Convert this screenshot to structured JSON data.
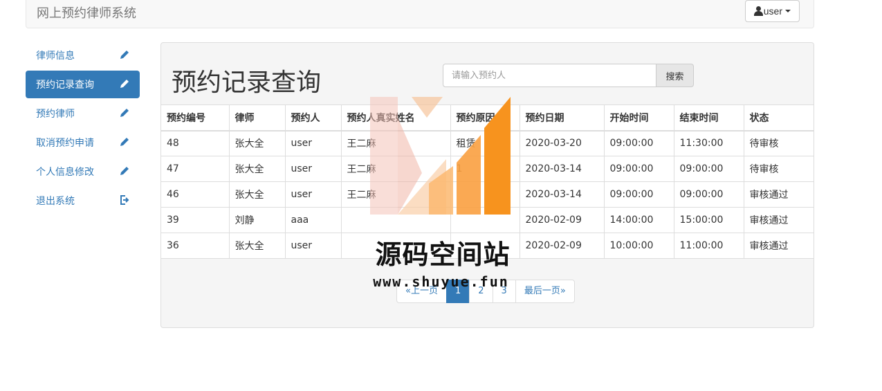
{
  "app": {
    "brand": "网上预约律师系统",
    "user_menu_label": "user"
  },
  "sidebar": {
    "items": [
      {
        "label": "律师信息",
        "icon": "pencil-icon",
        "active": false
      },
      {
        "label": "预约记录查询",
        "icon": "pencil-icon",
        "active": true
      },
      {
        "label": "预约律师",
        "icon": "pencil-icon",
        "active": false
      },
      {
        "label": "取消预约申请",
        "icon": "pencil-icon",
        "active": false
      },
      {
        "label": "个人信息修改",
        "icon": "pencil-icon",
        "active": false
      },
      {
        "label": "退出系统",
        "icon": "logout-icon",
        "active": false
      }
    ]
  },
  "main": {
    "title": "预约记录查询",
    "search": {
      "placeholder": "请输入预约人",
      "value": "",
      "button_label": "搜索"
    },
    "table": {
      "columns": [
        "预约编号",
        "律师",
        "预约人",
        "预约人真实姓名",
        "预约原因",
        "预约日期",
        "开始时间",
        "结束时间",
        "状态"
      ],
      "rows": [
        [
          "48",
          "张大全",
          "user",
          "王二麻",
          "租赁",
          "2020-03-20",
          "09:00:00",
          "11:30:00",
          "待审核"
        ],
        [
          "47",
          "张大全",
          "user",
          "王二麻",
          "1",
          "2020-03-14",
          "09:00:00",
          "09:00:00",
          "待审核"
        ],
        [
          "46",
          "张大全",
          "user",
          "王二麻",
          "",
          "2020-03-14",
          "09:00:00",
          "09:00:00",
          "审核通过"
        ],
        [
          "39",
          "刘静",
          "aaa",
          "",
          "",
          "2020-02-09",
          "14:00:00",
          "15:00:00",
          "审核通过"
        ],
        [
          "36",
          "张大全",
          "user",
          "",
          "",
          "2020-02-09",
          "10:00:00",
          "11:00:00",
          "审核通过"
        ]
      ]
    },
    "pagination": {
      "prev_label": "«上一页",
      "pages": [
        "1",
        "2",
        "3"
      ],
      "current_page": "1",
      "last_label": "最后一页»"
    }
  },
  "watermark": {
    "title": "源码空间站",
    "url": "www.shuyue.fun"
  },
  "colors": {
    "primary": "#337ab7",
    "watermark_orange": "#f7931e"
  }
}
